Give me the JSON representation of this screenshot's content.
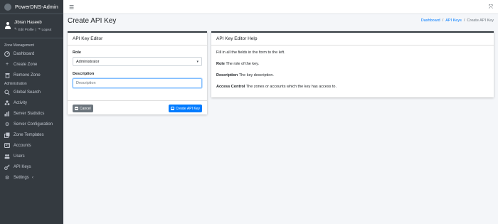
{
  "brand": {
    "name": "PowerDNS-Admin"
  },
  "user": {
    "name": "Jibran Haseeb",
    "edit_profile": "Edit Profile",
    "separator": "|",
    "logout": "Logout"
  },
  "sidebar": {
    "zone_header": "Zone Management",
    "zone_items": [
      {
        "label": "Dashboard",
        "icon": "dashboard-icon"
      },
      {
        "label": "Create Zone",
        "icon": "plus-icon"
      },
      {
        "label": "Remove Zone",
        "icon": "trash-icon"
      }
    ],
    "admin_header": "Administration",
    "admin_items": [
      {
        "label": "Global Search",
        "icon": "search-icon"
      },
      {
        "label": "Activity",
        "icon": "activity-icon"
      },
      {
        "label": "Server Statistics",
        "icon": "chart-icon"
      },
      {
        "label": "Server Configuration",
        "icon": "gear-icon"
      },
      {
        "label": "Zone Templates",
        "icon": "clone-icon"
      },
      {
        "label": "Accounts",
        "icon": "accounts-icon"
      },
      {
        "label": "Users",
        "icon": "users-icon"
      },
      {
        "label": "API Keys",
        "icon": "key-icon"
      },
      {
        "label": "Settings",
        "icon": "cog-icon",
        "has_caret": true
      }
    ]
  },
  "topbar": {
    "menu_icon": "☰",
    "expand_icon": "⤧"
  },
  "page": {
    "title": "Create API Key"
  },
  "breadcrumb": {
    "items": [
      "Dashboard",
      "API Keys",
      "Create API Key"
    ],
    "separator": "/"
  },
  "editor": {
    "header": "API Key Editor",
    "role_label": "Role",
    "role_value": "Administrator",
    "description_label": "Description",
    "description_placeholder": "Description",
    "cancel_label": "Cancel",
    "create_label": "Create API Key"
  },
  "help": {
    "header": "API Key Editor Help",
    "intro": "Fill in all the fields in the form to the left.",
    "role_term": "Role",
    "role_text": "The role of the key.",
    "description_term": "Description",
    "description_text": "The key description.",
    "access_term": "Access Control",
    "access_text": "The zones or accounts which the key has access to."
  },
  "colors": {
    "sidebar_bg": "#343a40",
    "primary": "#007bff",
    "secondary": "#6c757d",
    "content_bg": "#f4f6f9"
  }
}
